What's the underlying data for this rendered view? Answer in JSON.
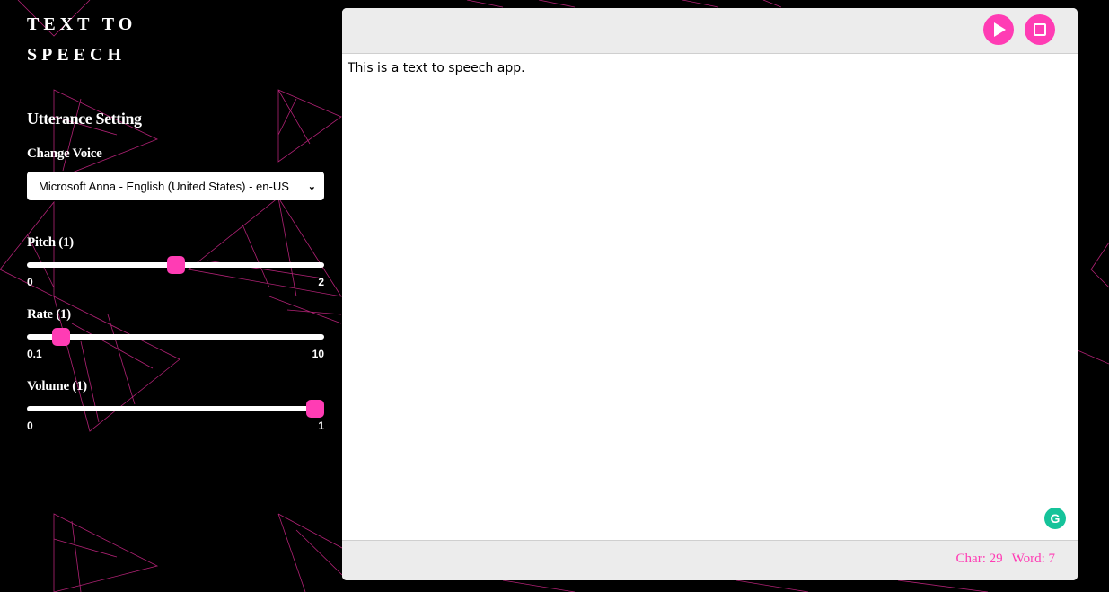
{
  "app": {
    "title_line1": "Text to",
    "title_line2": "Speech"
  },
  "settings": {
    "section_title": "Utterance Setting",
    "voice_label": "Change Voice",
    "voice_selected": "Microsoft Anna - English (United States) - en-US",
    "pitch": {
      "label": "Pitch (1)",
      "min": "0",
      "max": "2",
      "value": 1,
      "min_num": 0,
      "max_num": 2
    },
    "rate": {
      "label": "Rate (1)",
      "min": "0.1",
      "max": "10",
      "value": 1,
      "min_num": 0.1,
      "max_num": 10
    },
    "volume": {
      "label": "Volume (1)",
      "min": "0",
      "max": "1",
      "value": 1,
      "min_num": 0,
      "max_num": 1
    }
  },
  "editor": {
    "text": "This is a text to speech app.",
    "play_icon": "play-icon",
    "stop_icon": "stop-icon",
    "grammar_icon": "G"
  },
  "footer": {
    "char_count": "Char: 29",
    "word_count": "Word: 7"
  },
  "colors": {
    "accent": "#ff3cb4",
    "background": "#000000",
    "panel_bar": "#ececec",
    "grammar": "#15c39a"
  }
}
